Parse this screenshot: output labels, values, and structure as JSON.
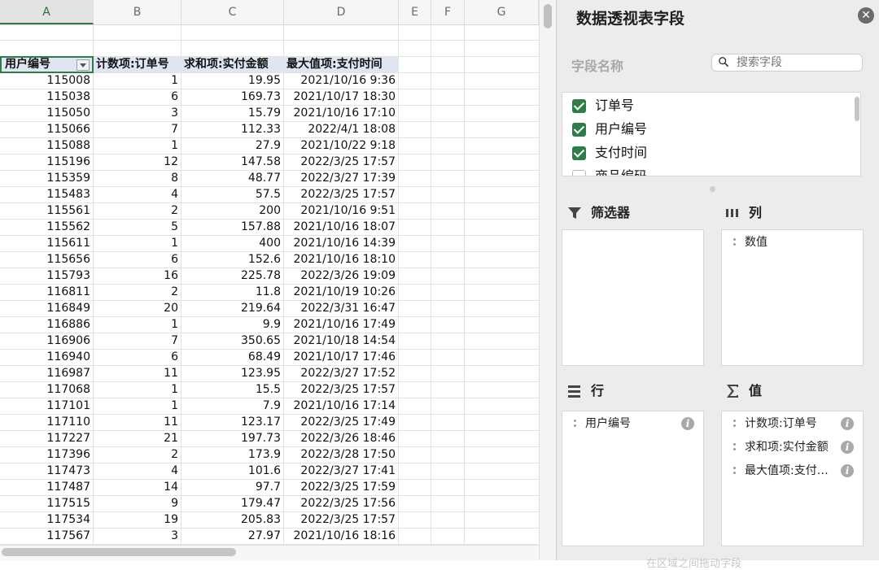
{
  "spreadsheet": {
    "columns": [
      "A",
      "B",
      "C",
      "D",
      "E",
      "F",
      "G"
    ],
    "header": [
      "用户编号",
      "计数项:订单号",
      "求和项:实付金额",
      "最大值项:支付时间"
    ],
    "rows": [
      [
        "115008",
        "1",
        "19.95",
        "2021/10/16 9:36"
      ],
      [
        "115038",
        "6",
        "169.73",
        "2021/10/17 18:30"
      ],
      [
        "115050",
        "3",
        "15.79",
        "2021/10/16 17:10"
      ],
      [
        "115066",
        "7",
        "112.33",
        "2022/4/1 18:08"
      ],
      [
        "115088",
        "1",
        "27.9",
        "2021/10/22 9:18"
      ],
      [
        "115196",
        "12",
        "147.58",
        "2022/3/25 17:57"
      ],
      [
        "115359",
        "8",
        "48.77",
        "2022/3/27 17:39"
      ],
      [
        "115483",
        "4",
        "57.5",
        "2022/3/25 17:57"
      ],
      [
        "115561",
        "2",
        "200",
        "2021/10/16 9:51"
      ],
      [
        "115562",
        "5",
        "157.88",
        "2021/10/16 18:07"
      ],
      [
        "115611",
        "1",
        "400",
        "2021/10/16 14:39"
      ],
      [
        "115656",
        "6",
        "152.6",
        "2021/10/16 18:10"
      ],
      [
        "115793",
        "16",
        "225.78",
        "2022/3/26 19:09"
      ],
      [
        "116811",
        "2",
        "11.8",
        "2021/10/19 10:26"
      ],
      [
        "116849",
        "20",
        "219.64",
        "2022/3/31 16:47"
      ],
      [
        "116886",
        "1",
        "9.9",
        "2021/10/16 17:49"
      ],
      [
        "116906",
        "7",
        "350.65",
        "2021/10/18 14:54"
      ],
      [
        "116940",
        "6",
        "68.49",
        "2021/10/17 17:46"
      ],
      [
        "116987",
        "11",
        "123.95",
        "2022/3/27 17:52"
      ],
      [
        "117068",
        "1",
        "15.5",
        "2022/3/25 17:57"
      ],
      [
        "117101",
        "1",
        "7.9",
        "2021/10/16 17:14"
      ],
      [
        "117110",
        "11",
        "123.17",
        "2022/3/25 17:49"
      ],
      [
        "117227",
        "21",
        "197.73",
        "2022/3/26 18:46"
      ],
      [
        "117396",
        "2",
        "173.9",
        "2022/3/28 17:50"
      ],
      [
        "117473",
        "4",
        "101.6",
        "2022/3/27 17:41"
      ],
      [
        "117487",
        "14",
        "97.7",
        "2022/3/25 17:59"
      ],
      [
        "117515",
        "9",
        "179.47",
        "2022/3/25 17:56"
      ],
      [
        "117534",
        "19",
        "205.83",
        "2022/3/25 17:57"
      ],
      [
        "117567",
        "3",
        "27.97",
        "2021/10/16 18:16"
      ]
    ]
  },
  "pivot_panel": {
    "title": "数据透视表字段",
    "field_name_label": "字段名称",
    "search_placeholder": "搜索字段",
    "fields": [
      {
        "label": "订单号",
        "checked": true
      },
      {
        "label": "用户编号",
        "checked": true
      },
      {
        "label": "支付时间",
        "checked": true
      },
      {
        "label": "商品编码",
        "checked": false
      }
    ],
    "areas": {
      "filters": {
        "label": "筛选器",
        "items": []
      },
      "columns": {
        "label": "列",
        "items": [
          "数值"
        ]
      },
      "rows": {
        "label": "行",
        "items": [
          "用户编号"
        ]
      },
      "values": {
        "label": "值",
        "items": [
          "计数项:订单号",
          "求和项:实付金额",
          "最大值项:支付…"
        ]
      }
    },
    "bottom_hint": "在区域之间拖动字段"
  },
  "colors": {
    "accent_green": "#2f7d46",
    "header_row_bg": "#dfe6f2",
    "panel_bg": "#ececec"
  }
}
